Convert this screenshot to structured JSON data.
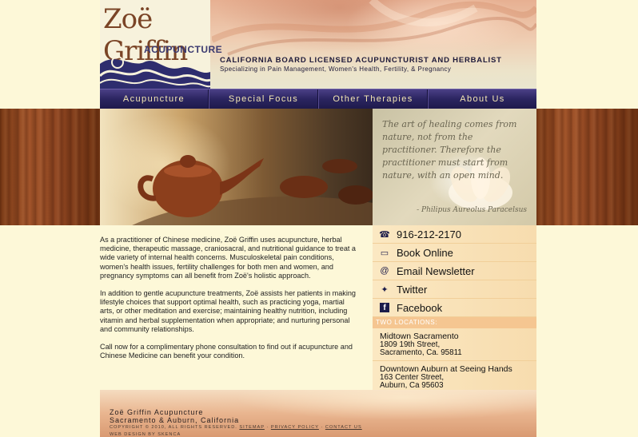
{
  "header": {
    "logo_name": "Zoë Griffin",
    "logo_sub": "ACUPUNCTURE",
    "tagline": "CALIFORNIA BOARD LICENSED ACUPUNCTURIST AND HERBALIST",
    "subtagline": "Specializing in Pain Management, Women's Health, Fertility, & Pregnancy"
  },
  "nav": [
    "Acupuncture",
    "Special Focus",
    "Other Therapies",
    "About Us"
  ],
  "quote": {
    "text": "The art of healing comes from nature, not from the practitioner. Therefore the practitioner must start from nature, with an open mind.",
    "author": "- Philipus Aureolus Paracelsus"
  },
  "content": {
    "p1": "As a practitioner of Chinese medicine, Zoë Griffin uses acupuncture, herbal medicine, therapeutic massage, craniosacral, and nutritional guidance to treat a wide variety of internal health concerns. Musculoskeletal pain conditions, women's health issues, fertility challenges for both men and women, and pregnancy symptoms can all benefit from Zoë's holistic approach.",
    "p2": "In addition to gentle acupuncture treatments, Zoë assists her patients in making lifestyle choices that support optimal health, such as practicing yoga, martial arts, or other meditation and exercise; maintaining healthy nutrition, including vitamin and herbal supplementation when appropriate; and nurturing personal and community relationships.",
    "p3": "Call now for a complimentary phone consultation to find out if acupuncture and Chinese Medicine can benefit your condition."
  },
  "sidebar": {
    "links": [
      {
        "label": "916-212-2170",
        "icon": "phone-icon"
      },
      {
        "label": "Book Online",
        "icon": "calendar-icon"
      },
      {
        "label": "Email Newsletter",
        "icon": "email-icon"
      },
      {
        "label": "Twitter",
        "icon": "twitter-bird-icon"
      },
      {
        "label": "Facebook",
        "icon": "facebook-icon"
      }
    ],
    "locations_heading": "TWO LOCATIONS:",
    "locations": [
      {
        "name": "Midtown Sacramento",
        "street": "1809 19th Street,",
        "city": "Sacramento, Ca. 95811"
      },
      {
        "name": "Downtown Auburn at Seeing Hands",
        "street": "163 Center Street,",
        "city": "Auburn, Ca 95603"
      }
    ]
  },
  "footer": {
    "name": "Zoë Griffin Acupuncture",
    "locations": "Sacramento & Auburn, California",
    "copyright": "COPYRIGHT © 2010, ALL RIGHTS RESERVED.",
    "links": [
      "SITEMAP",
      "PRIVACY POLICY",
      "CONTACT US"
    ],
    "credit": "WEB DESIGN BY SKENCA"
  }
}
